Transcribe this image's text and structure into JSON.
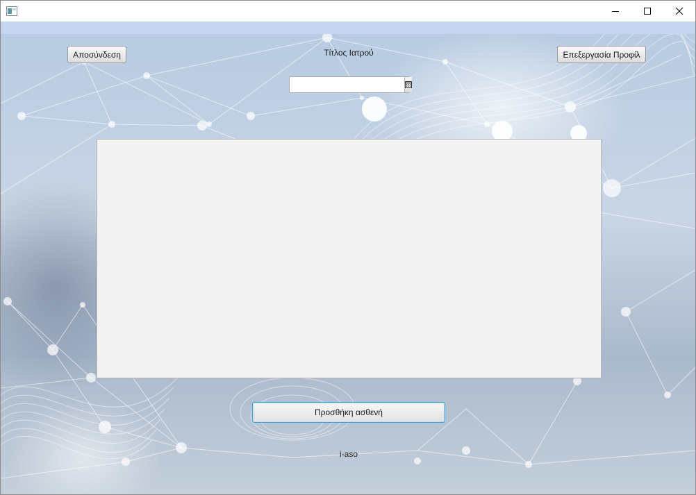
{
  "window": {
    "icon": "java-app-icon",
    "controls": [
      "minimize-icon",
      "maximize-icon",
      "close-icon"
    ]
  },
  "header": {
    "logout_label": "Αποσύνδεση",
    "doctor_title": "Τίτλος Ιατρού",
    "edit_profile_label": "Επεξεργασία Προφίλ"
  },
  "date_picker": {
    "value": "",
    "placeholder": "",
    "button_icon": "calendar-icon"
  },
  "patient_list": {
    "items": []
  },
  "actions": {
    "add_patient_label": "Προσθήκη ασθενή"
  },
  "footer": {
    "brand": "i-aso"
  },
  "colors": {
    "focus_border": "#3f9fd8",
    "list_background": "#f3f3f3",
    "strip": "#c5d6ee"
  }
}
